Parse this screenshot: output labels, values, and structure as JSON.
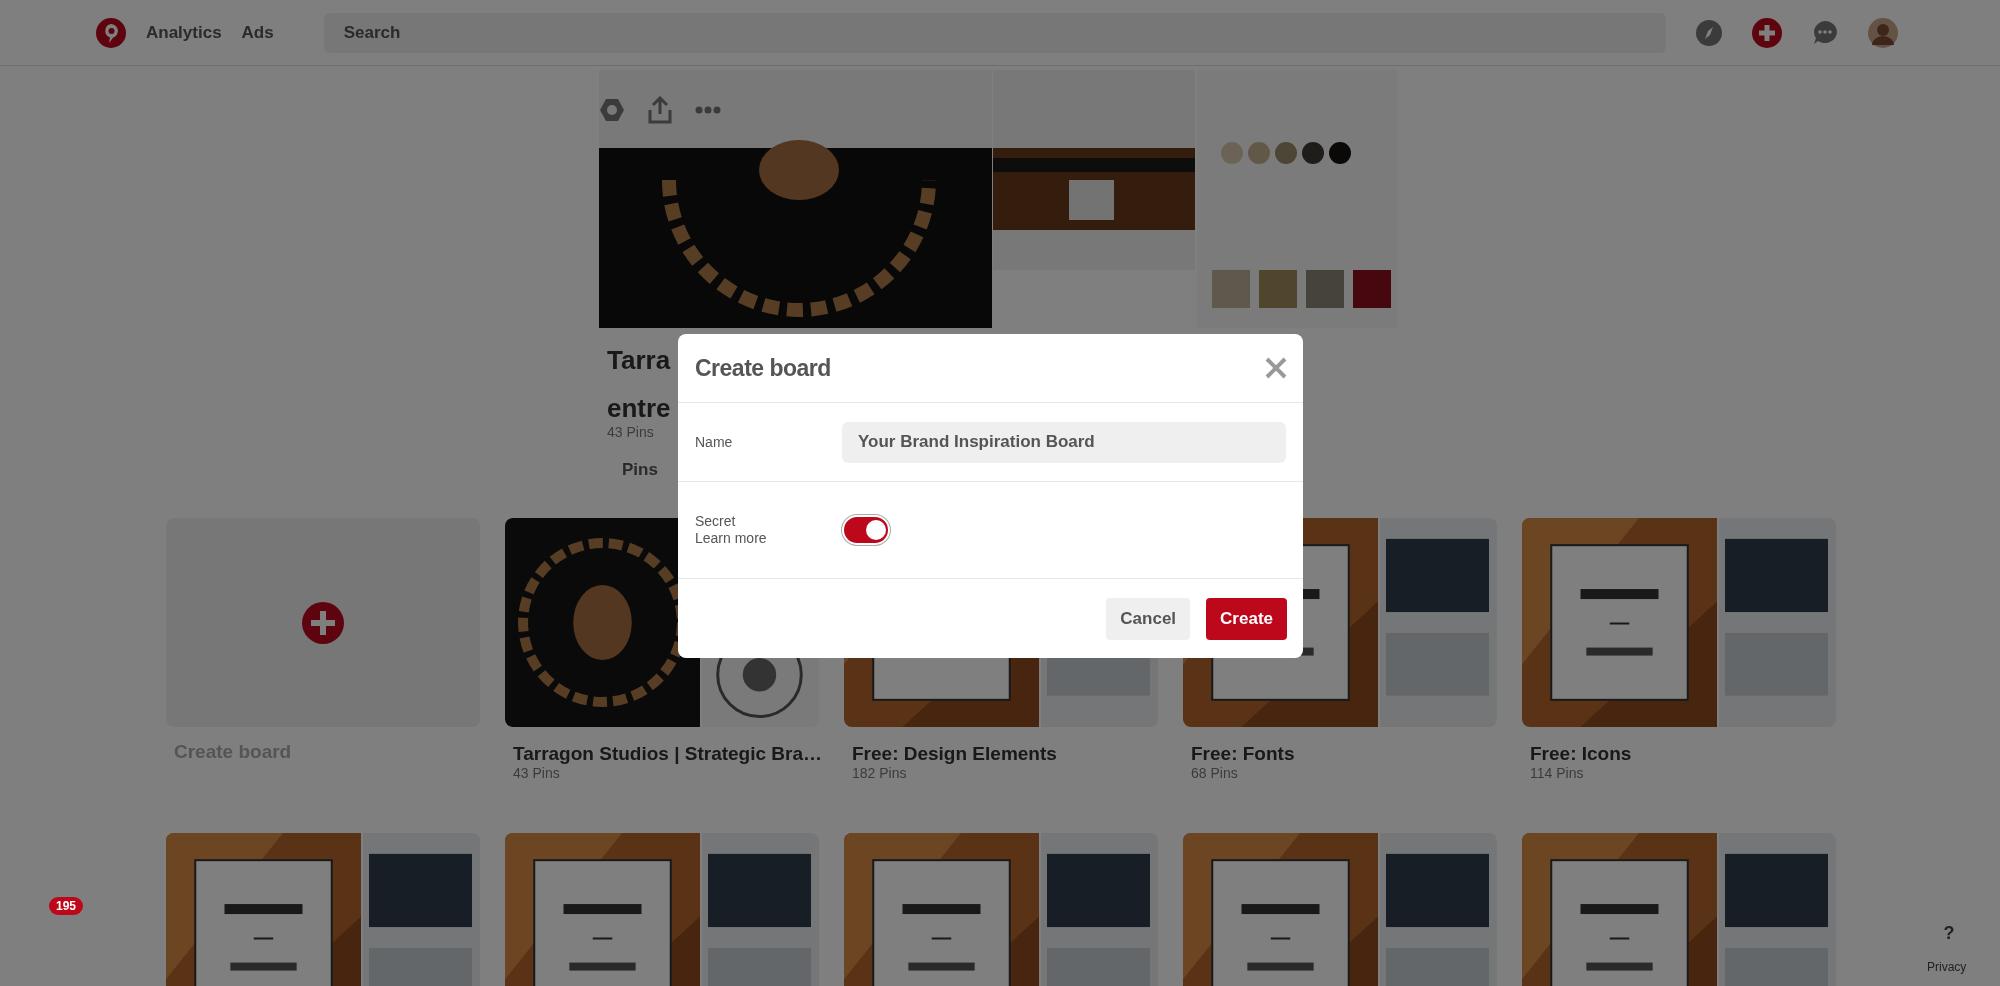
{
  "header": {
    "nav": [
      {
        "label": "Analytics"
      },
      {
        "label": "Ads"
      }
    ],
    "search": {
      "placeholder": "Search"
    }
  },
  "profile": {
    "title_lines": [
      "Tarra",
      "entre"
    ],
    "pin_count": "43 Pins",
    "tab": "Pins"
  },
  "boards": [
    {
      "kind": "create",
      "title": "Create board"
    },
    {
      "kind": "board",
      "title": "Tarragon Studios | Strategic Bra…",
      "pins": "43 Pins"
    },
    {
      "kind": "board",
      "title": "Free: Design Elements",
      "pins": "182 Pins"
    },
    {
      "kind": "board",
      "title": "Free: Fonts",
      "pins": "68 Pins"
    },
    {
      "kind": "board",
      "title": "Free: Icons",
      "pins": "114 Pins"
    },
    {
      "kind": "board"
    },
    {
      "kind": "board"
    },
    {
      "kind": "board"
    },
    {
      "kind": "board"
    },
    {
      "kind": "board"
    }
  ],
  "dialog": {
    "title": "Create board",
    "name_label": "Name",
    "name_value": "Your Brand Inspiration Board",
    "secret": {
      "label": "Secret",
      "link": "Learn more",
      "on": true
    },
    "buttons": [
      {
        "label": "Cancel",
        "kind": "secondary"
      },
      {
        "label": "Create",
        "kind": "primary"
      }
    ]
  },
  "notifications": {
    "count": "195"
  },
  "help": {
    "label": "?",
    "privacy": "Privacy"
  }
}
